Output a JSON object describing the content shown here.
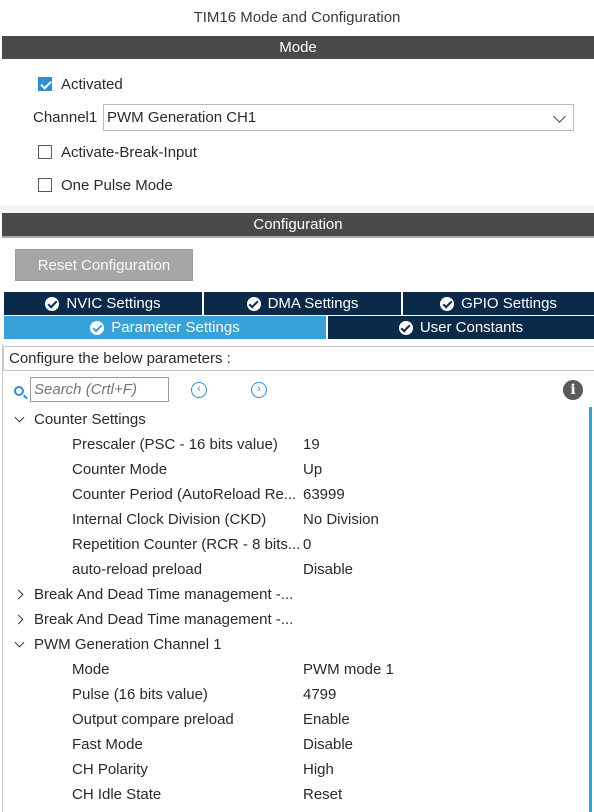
{
  "window": {
    "title": "TIM16 Mode and Configuration"
  },
  "mode_section": {
    "header": "Mode",
    "activated": {
      "label": "Activated",
      "checked": true
    },
    "channel1": {
      "label": "Channel1",
      "selected": "PWM Generation CH1"
    },
    "activate_break_input": {
      "label": "Activate-Break-Input",
      "checked": false
    },
    "one_pulse_mode": {
      "label": "One Pulse Mode",
      "checked": false
    }
  },
  "config_section": {
    "header": "Configuration",
    "reset_button": "Reset Configuration",
    "tabs": [
      {
        "label": "NVIC Settings",
        "icon": "check-circle-icon",
        "active": false
      },
      {
        "label": "DMA Settings",
        "icon": "check-circle-icon",
        "active": false
      },
      {
        "label": "GPIO Settings",
        "icon": "check-circle-icon",
        "active": false
      },
      {
        "label": "Parameter Settings",
        "icon": "check-circle-icon",
        "active": true
      },
      {
        "label": "User Constants",
        "icon": "check-circle-icon",
        "active": false
      }
    ]
  },
  "params": {
    "header": "Configure the below parameters :",
    "search_placeholder": "Search (Crtl+F)",
    "prev_glyph": "‹",
    "next_glyph": "›",
    "info_glyph": "i",
    "groups": [
      {
        "label": "Counter Settings",
        "expanded": true,
        "items": [
          {
            "name": "Prescaler (PSC - 16 bits value)",
            "value": "19"
          },
          {
            "name": "Counter Mode",
            "value": "Up"
          },
          {
            "name": "Counter Period (AutoReload Re...",
            "value": "63999"
          },
          {
            "name": "Internal Clock Division (CKD)",
            "value": "No Division"
          },
          {
            "name": "Repetition Counter (RCR - 8 bits...",
            "value": "0"
          },
          {
            "name": "auto-reload preload",
            "value": "Disable"
          }
        ]
      },
      {
        "label": "Break And Dead Time management -...",
        "expanded": false,
        "items": []
      },
      {
        "label": "Break And Dead Time management -...",
        "expanded": false,
        "items": []
      },
      {
        "label": "PWM Generation Channel 1",
        "expanded": true,
        "items": [
          {
            "name": "Mode",
            "value": "PWM mode 1"
          },
          {
            "name": "Pulse (16 bits value)",
            "value": "4799"
          },
          {
            "name": "Output compare preload",
            "value": "Enable"
          },
          {
            "name": "Fast Mode",
            "value": "Disable"
          },
          {
            "name": "CH Polarity",
            "value": "High"
          },
          {
            "name": "CH Idle State",
            "value": "Reset"
          }
        ]
      }
    ]
  },
  "colors": {
    "section_bar": "#4a4a4a",
    "tab_dark": "#0b2a4a",
    "tab_active": "#37a1d8",
    "checkbox_checked": "#2f8fd0",
    "reset_button": "#a6a6a6"
  }
}
